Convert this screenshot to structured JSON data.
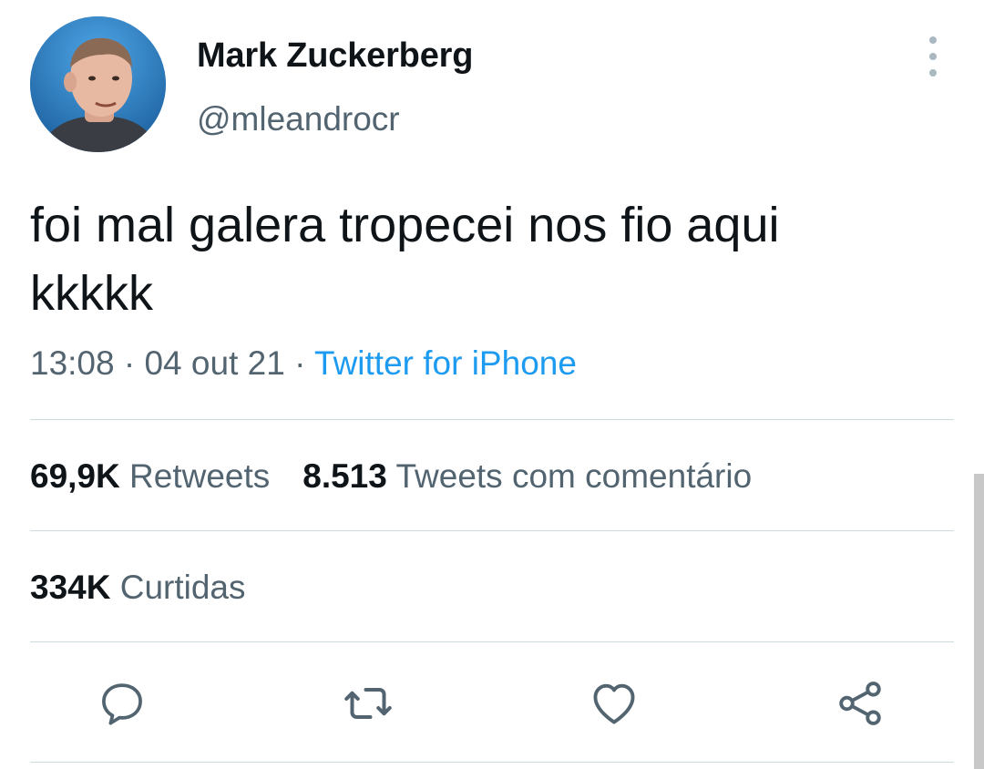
{
  "tweet": {
    "author": {
      "display_name": "Mark Zuckerberg",
      "handle": "@mleandrocr"
    },
    "text": "foi mal galera tropecei nos fio aqui\nkkkkk",
    "time": "13:08",
    "date": "04 out 21",
    "separator": " · ",
    "source": "Twitter for iPhone"
  },
  "stats": {
    "retweets_count": "69,9K",
    "retweets_label": "Retweets",
    "quote_count": "8.513",
    "quote_label": "Tweets com comentário",
    "likes_count": "334K",
    "likes_label": "Curtidas"
  },
  "actions": {
    "reply_icon": "comment-icon",
    "retweet_icon": "retweet-icon",
    "like_icon": "heart-icon",
    "share_icon": "share-icon"
  },
  "colors": {
    "text": "#0f1419",
    "secondary_text": "#536471",
    "link": "#1d9bf0",
    "divider": "#cfd9de",
    "icon": "#536471"
  }
}
